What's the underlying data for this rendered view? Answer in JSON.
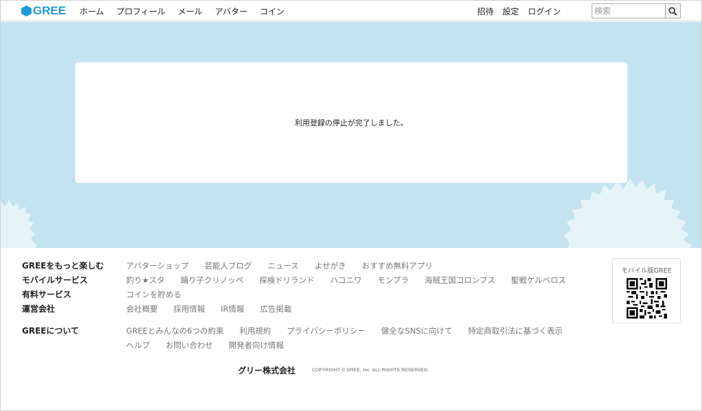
{
  "header": {
    "logo": "GREE",
    "nav_left": [
      "ホーム",
      "プロフィール",
      "メール",
      "アバター",
      "コイン"
    ],
    "nav_right": [
      "招待",
      "設定",
      "ログイン"
    ],
    "search_placeholder": "検索"
  },
  "main": {
    "message": "利用登録の停止が完了しました。"
  },
  "footer": {
    "categories": {
      "enjoy": "GREEをもっと楽しむ",
      "mobile": "モバイルサービス",
      "paid": "有料サービス",
      "company": "運営会社",
      "about": "GREEについて"
    },
    "enjoy_links": [
      "アバターショップ",
      "芸能人ブログ",
      "ニュース",
      "よせがき",
      "おすすめ無料アプリ"
    ],
    "mobile_links": [
      "釣り★スタ",
      "踊り子クリノッペ",
      "探検ドリランド",
      "ハコニワ",
      "モンプラ",
      "海賊王国コロンブス",
      "聖戦ケルベロス"
    ],
    "paid_links": [
      "コインを貯める"
    ],
    "company_links": [
      "会社概要",
      "採用情報",
      "IR情報",
      "広告掲載"
    ],
    "about_links_1": [
      "GREEとみんなの6つの約束",
      "利用規約",
      "プライバシーポリシー",
      "健全なSNSに向けて",
      "特定商取引法に基づく表示"
    ],
    "about_links_2": [
      "ヘルプ",
      "お問い合わせ",
      "開発者向け情報"
    ],
    "qr_title": "モバイル版GREE",
    "corp_name": "グリー株式会社",
    "copyright": "COPYRIGHT © GREE, Inc. ALL RIGHTS RESERVED."
  },
  "colors": {
    "brand": "#1e9ad6",
    "main_bg": "#c3e4ee"
  }
}
